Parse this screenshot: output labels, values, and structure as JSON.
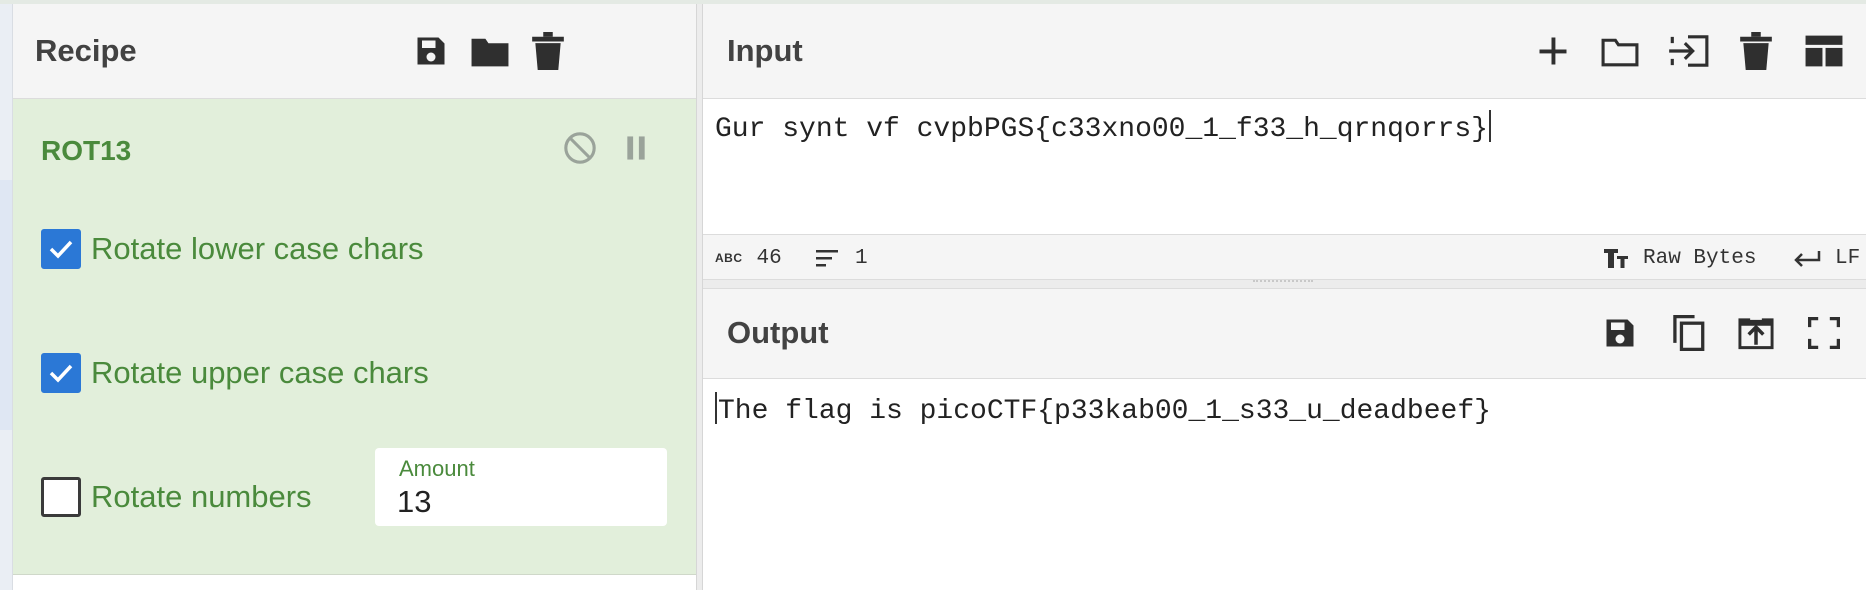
{
  "recipe": {
    "title": "Recipe",
    "operation": {
      "name": "ROT13",
      "options": [
        {
          "label": "Rotate lower case chars",
          "checked": true
        },
        {
          "label": "Rotate upper case chars",
          "checked": true
        },
        {
          "label": "Rotate numbers",
          "checked": false
        }
      ],
      "amount_label": "Amount",
      "amount_value": "13"
    },
    "icons": [
      "save-icon",
      "folder-icon",
      "trash-icon",
      "disable-icon",
      "pause-icon"
    ]
  },
  "input": {
    "title": "Input",
    "text": "Gur synt vf cvpbPGS{c33xno00_1_f33_h_qrnqorrs}",
    "status": {
      "abc_label": "ABC",
      "length": "46",
      "lines": "1",
      "encoding": "Raw Bytes",
      "eol": "LF"
    },
    "icons": [
      "plus-icon",
      "folder-icon",
      "import-icon",
      "trash-icon",
      "layout-icon"
    ]
  },
  "output": {
    "title": "Output",
    "text": "The flag is picoCTF{p33kab00_1_s33_u_deadbeef}",
    "icons": [
      "save-icon",
      "copy-icon",
      "replace-input-icon",
      "maximize-icon"
    ]
  },
  "colors": {
    "operation_bg": "#e2efdb",
    "operation_text": "#4a8a3c",
    "checkbox_on": "#2b78d6",
    "header_bg": "#f5f5f5"
  }
}
